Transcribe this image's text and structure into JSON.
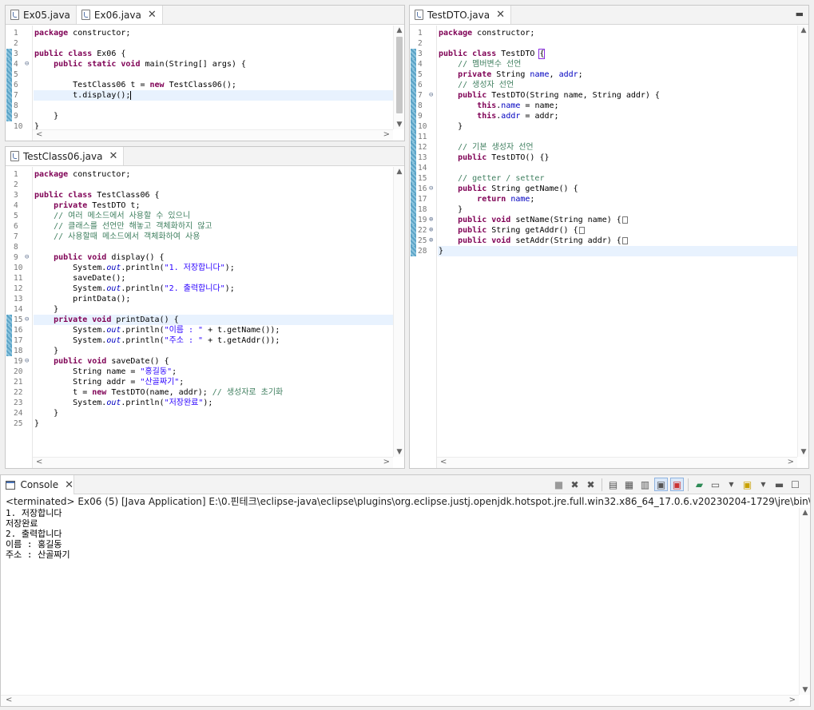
{
  "colors": {
    "keyword": "#7f0055",
    "string": "#2a00ff",
    "comment": "#3f7f5f",
    "field": "#0000c0",
    "current_line": "#e8f2fe",
    "change_marker": "#5aa3c7"
  },
  "pane_ex06": {
    "tabs": [
      {
        "label": "Ex05.java",
        "active": false,
        "closable": false
      },
      {
        "label": "Ex06.java",
        "active": true,
        "closable": true
      }
    ],
    "lines": [
      {
        "n": "1",
        "code": "<span class='kw'>package</span> constructor;"
      },
      {
        "n": "2",
        "code": ""
      },
      {
        "n": "3",
        "code": "<span class='kw'>public class</span> Ex06 {",
        "chg": true
      },
      {
        "n": "4",
        "fold": "⊖",
        "code": "    <span class='kw'>public static void</span> main(String[] args) {",
        "chg": true
      },
      {
        "n": "5",
        "code": "",
        "chg": true
      },
      {
        "n": "6",
        "code": "        TestClass06 t = <span class='kw'>new</span> TestClass06();",
        "chg": true
      },
      {
        "n": "7",
        "code": "        t.display();<span class='caret'></span>",
        "chg": true,
        "hl": true
      },
      {
        "n": "8",
        "code": "",
        "chg": true
      },
      {
        "n": "9",
        "code": "    }",
        "chg": true
      },
      {
        "n": "10",
        "code": "}"
      }
    ]
  },
  "pane_testclass06": {
    "tabs": [
      {
        "label": "TestClass06.java",
        "active": true,
        "closable": true
      }
    ],
    "lines": [
      {
        "n": "1",
        "code": "<span class='kw'>package</span> constructor;"
      },
      {
        "n": "2",
        "code": ""
      },
      {
        "n": "3",
        "code": "<span class='kw'>public class</span> TestClass06 {"
      },
      {
        "n": "4",
        "code": "    <span class='kw'>private</span> TestDTO t;"
      },
      {
        "n": "5",
        "code": "    <span class='cm'>// 여러 메소드에서 사용할 수 있으니</span>"
      },
      {
        "n": "6",
        "code": "    <span class='cm'>// 클래스를 선언만 해놓고 객체화하지 않고</span>"
      },
      {
        "n": "7",
        "code": "    <span class='cm'>// 사용할때 메소드에서 객체화하여 사용</span>"
      },
      {
        "n": "8",
        "code": ""
      },
      {
        "n": "9",
        "fold": "⊖",
        "code": "    <span class='kw'>public void</span> display() {"
      },
      {
        "n": "10",
        "code": "        System.<span class='st'>out</span>.println(<span class='str'>\"1. 저장합니다\"</span>);"
      },
      {
        "n": "11",
        "code": "        saveDate();"
      },
      {
        "n": "12",
        "code": "        System.<span class='st'>out</span>.println(<span class='str'>\"2. 출력합니다\"</span>);"
      },
      {
        "n": "13",
        "code": "        printData();"
      },
      {
        "n": "14",
        "code": "    }"
      },
      {
        "n": "15",
        "fold": "⊖",
        "code": "    <span class='kw'>private void</span> printData() {",
        "chg": true,
        "hl": true
      },
      {
        "n": "16",
        "code": "        System.<span class='st'>out</span>.println(<span class='str'>\"이름 : \"</span> + t.getName());",
        "chg": true
      },
      {
        "n": "17",
        "code": "        System.<span class='st'>out</span>.println(<span class='str'>\"주소 : \"</span> + t.getAddr());",
        "chg": true
      },
      {
        "n": "18",
        "code": "    }",
        "chg": true
      },
      {
        "n": "19",
        "fold": "⊖",
        "code": "    <span class='kw'>public void</span> saveDate() {"
      },
      {
        "n": "20",
        "code": "        String name = <span class='str'>\"홍길동\"</span>;"
      },
      {
        "n": "21",
        "code": "        String addr = <span class='str'>\"산골짜기\"</span>;"
      },
      {
        "n": "22",
        "code": "        t = <span class='kw'>new</span> TestDTO(name, addr); <span class='cm'>// 생성자로 초기화</span>"
      },
      {
        "n": "23",
        "code": "        System.<span class='st'>out</span>.println(<span class='str'>\"저장완료\"</span>);"
      },
      {
        "n": "24",
        "code": "    }"
      },
      {
        "n": "25",
        "code": "}"
      }
    ]
  },
  "pane_testdto": {
    "tabs": [
      {
        "label": "TestDTO.java",
        "active": true,
        "closable": true
      }
    ],
    "lines": [
      {
        "n": "1",
        "code": "<span class='kw'>package</span> constructor;"
      },
      {
        "n": "2",
        "code": ""
      },
      {
        "n": "3",
        "code": "<span class='kw'>public class</span> TestDTO <span class='brkt'>{</span>",
        "chg": true
      },
      {
        "n": "4",
        "code": "    <span class='cm'>// 멤버변수 선언</span>",
        "chg": true
      },
      {
        "n": "5",
        "code": "    <span class='kw'>private</span> String <span class='fld'>name</span>, <span class='fld'>addr</span>;",
        "chg": true
      },
      {
        "n": "6",
        "code": "    <span class='cm'>// 생성자 선언</span>",
        "chg": true
      },
      {
        "n": "7",
        "fold": "⊖",
        "code": "    <span class='kw'>public</span> TestDTO(String name, String addr) {",
        "chg": true
      },
      {
        "n": "8",
        "code": "        <span class='kw'>this</span>.<span class='fld'>name</span> = name;",
        "chg": true
      },
      {
        "n": "9",
        "code": "        <span class='kw'>this</span>.<span class='fld'>addr</span> = addr;",
        "chg": true
      },
      {
        "n": "10",
        "code": "    }",
        "chg": true
      },
      {
        "n": "11",
        "code": "",
        "chg": true
      },
      {
        "n": "12",
        "code": "    <span class='cm'>// 기본 생성자 선언</span>",
        "chg": true
      },
      {
        "n": "13",
        "code": "    <span class='kw'>public</span> TestDTO() {}",
        "chg": true
      },
      {
        "n": "14",
        "code": "",
        "chg": true
      },
      {
        "n": "15",
        "code": "    <span class='cm'>// getter / setter</span>",
        "chg": true
      },
      {
        "n": "16",
        "fold": "⊖",
        "code": "    <span class='kw'>public</span> String getName() {",
        "chg": true
      },
      {
        "n": "17",
        "code": "        <span class='kw'>return</span> <span class='fld'>name</span>;",
        "chg": true
      },
      {
        "n": "18",
        "code": "    }",
        "chg": true
      },
      {
        "n": "19",
        "fold": "⊕",
        "code": "    <span class='kw'>public void</span> setName(String name) {<span class='boxmark'></span>",
        "chg": true
      },
      {
        "n": "22",
        "fold": "⊕",
        "code": "    <span class='kw'>public</span> String getAddr() {<span class='boxmark'></span>",
        "chg": true
      },
      {
        "n": "25",
        "fold": "⊕",
        "code": "    <span class='kw'>public void</span> setAddr(String addr) {<span class='boxmark'></span>",
        "chg": true
      },
      {
        "n": "28",
        "code": "}",
        "chg": true,
        "hl": true
      }
    ]
  },
  "console": {
    "tab_label": "Console",
    "status": "<terminated> Ex06 (5) [Java Application] E:\\0.핀테크\\eclipse-java\\eclipse\\plugins\\org.eclipse.justj.openjdk.hotspot.jre.full.win32.x86_64_17.0.6.v20230204-1729\\jre\\bin\\javaw.exe  (2",
    "output": [
      "1. 저장합니다",
      "저장완료",
      "2. 출력합니다",
      "이름 : 홍길동",
      "주소 : 산골짜기"
    ],
    "tools": [
      "terminate-icon",
      "remove-launch-icon",
      "remove-all-icon",
      "clear-console-icon",
      "scroll-lock-icon",
      "word-wrap-icon",
      "show-stdout-icon",
      "show-stderr-icon",
      "pin-console-icon",
      "display-console-icon",
      "open-console-icon",
      "minimize-icon",
      "maximize-icon"
    ]
  }
}
